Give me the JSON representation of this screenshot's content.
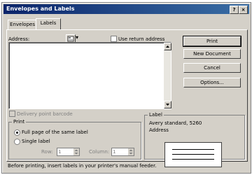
{
  "window": {
    "title": "Envelopes and Labels",
    "help_label": "?",
    "close_label": "×"
  },
  "tabs": [
    {
      "label": "Envelopes"
    },
    {
      "label": "Labels"
    }
  ],
  "address": {
    "label": "Address:",
    "value": ""
  },
  "use_return_address": {
    "label": "Use return address",
    "checked": false
  },
  "buttons": {
    "print": "Print",
    "new_document": "New Document",
    "cancel": "Cancel",
    "options": "Options..."
  },
  "delivery_point_barcode": {
    "label": "Delivery point barcode",
    "checked": false,
    "enabled": false
  },
  "print_group": {
    "title": "Print",
    "full_page": "Full page of the same label",
    "single_label": "Single label",
    "selected": "full_page",
    "row_label": "Row:",
    "row_value": "1",
    "column_label": "Column:",
    "column_value": "1"
  },
  "label_group": {
    "title": "Label",
    "line1": "Avery standard, 5260",
    "line2": "Address"
  },
  "status": {
    "text": "Before printing, insert labels in your printer's manual feeder."
  }
}
